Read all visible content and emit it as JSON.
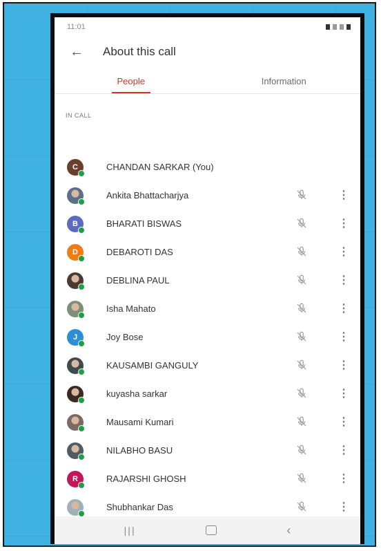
{
  "status_bar": {
    "time": "11:01"
  },
  "header": {
    "back_icon": "arrow-left-icon",
    "title": "About this call"
  },
  "tabs": [
    {
      "label": "People",
      "active": true
    },
    {
      "label": "Information",
      "active": false
    }
  ],
  "section_label": "IN CALL",
  "participants": [
    {
      "name": "CHANDAN SARKAR (You)",
      "avatar_letter": "C",
      "avatar_color": "#6b3f2c",
      "photo": false,
      "muted": false,
      "more": false
    },
    {
      "name": "Ankita Bhattacharjya",
      "avatar_letter": "",
      "avatar_color": "#5a6f8c",
      "photo": true,
      "muted": true,
      "more": true
    },
    {
      "name": "BHARATI BISWAS",
      "avatar_letter": "B",
      "avatar_color": "#5c6bc0",
      "photo": false,
      "muted": true,
      "more": true
    },
    {
      "name": "DEBAROTI DAS",
      "avatar_letter": "D",
      "avatar_color": "#ef7d16",
      "photo": false,
      "muted": true,
      "more": true
    },
    {
      "name": "DEBLINA PAUL",
      "avatar_letter": "",
      "avatar_color": "#4a3a30",
      "photo": true,
      "muted": true,
      "more": true
    },
    {
      "name": "Isha Mahato",
      "avatar_letter": "",
      "avatar_color": "#7c8f78",
      "photo": true,
      "muted": true,
      "more": true
    },
    {
      "name": "Joy Bose",
      "avatar_letter": "J",
      "avatar_color": "#2b8fd6",
      "photo": false,
      "muted": true,
      "more": true
    },
    {
      "name": "KAUSAMBI GANGULY",
      "avatar_letter": "",
      "avatar_color": "#3e4a4e",
      "photo": true,
      "muted": true,
      "more": true
    },
    {
      "name": "kuyasha sarkar",
      "avatar_letter": "",
      "avatar_color": "#3b2a22",
      "photo": true,
      "muted": true,
      "more": true
    },
    {
      "name": "Mausami Kumari",
      "avatar_letter": "",
      "avatar_color": "#7a6a64",
      "photo": true,
      "muted": true,
      "more": true
    },
    {
      "name": "NILABHO BASU",
      "avatar_letter": "",
      "avatar_color": "#4f5b66",
      "photo": true,
      "muted": true,
      "more": true
    },
    {
      "name": "RAJARSHI GHOSH",
      "avatar_letter": "R",
      "avatar_color": "#c2185b",
      "photo": false,
      "muted": true,
      "more": true
    },
    {
      "name": "Shubhankar Das",
      "avatar_letter": "",
      "avatar_color": "#9fb0b8",
      "photo": true,
      "muted": true,
      "more": true
    }
  ],
  "navbar": {
    "recent_icon": "recent-apps-icon",
    "home_icon": "home-icon",
    "back_icon": "back-triangle-icon"
  },
  "colors": {
    "accent": "#d93025",
    "online": "#1e9e47",
    "background": "#3fb1e3"
  }
}
